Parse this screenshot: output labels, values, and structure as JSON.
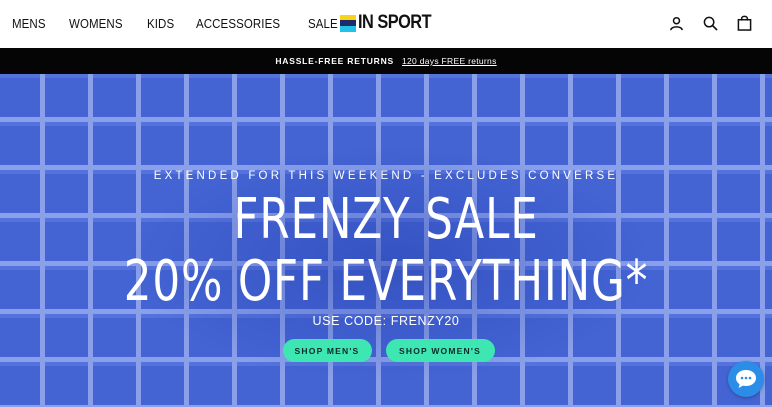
{
  "nav": {
    "items": [
      "MENS",
      "WOMENS",
      "KIDS",
      "ACCESSORIES",
      "SALE"
    ]
  },
  "logo": {
    "text": "IN SPORT",
    "colors": [
      "#f7d417",
      "#1f2a6b",
      "#22c1e6"
    ]
  },
  "header_icons": [
    "account-icon",
    "search-icon",
    "cart-icon"
  ],
  "announcement": {
    "label": "HASSLE-FREE RETURNS",
    "link": "120 days FREE returns"
  },
  "hero": {
    "subtitle": "EXTENDED FOR THIS WEEKEND - EXCLUDES CONVERSE",
    "title_line1": "FRENZY SALE",
    "title_line2": "20% OFF EVERYTHING*",
    "code": "USE CODE: FRENZY20",
    "buttons": [
      "SHOP MEN'S",
      "SHOP WOMEN'S"
    ],
    "colors": {
      "background": "#4363d3",
      "button": "#3ee6b2"
    }
  },
  "chat": {
    "icon": "chat-icon",
    "color": "#2b8de8"
  }
}
